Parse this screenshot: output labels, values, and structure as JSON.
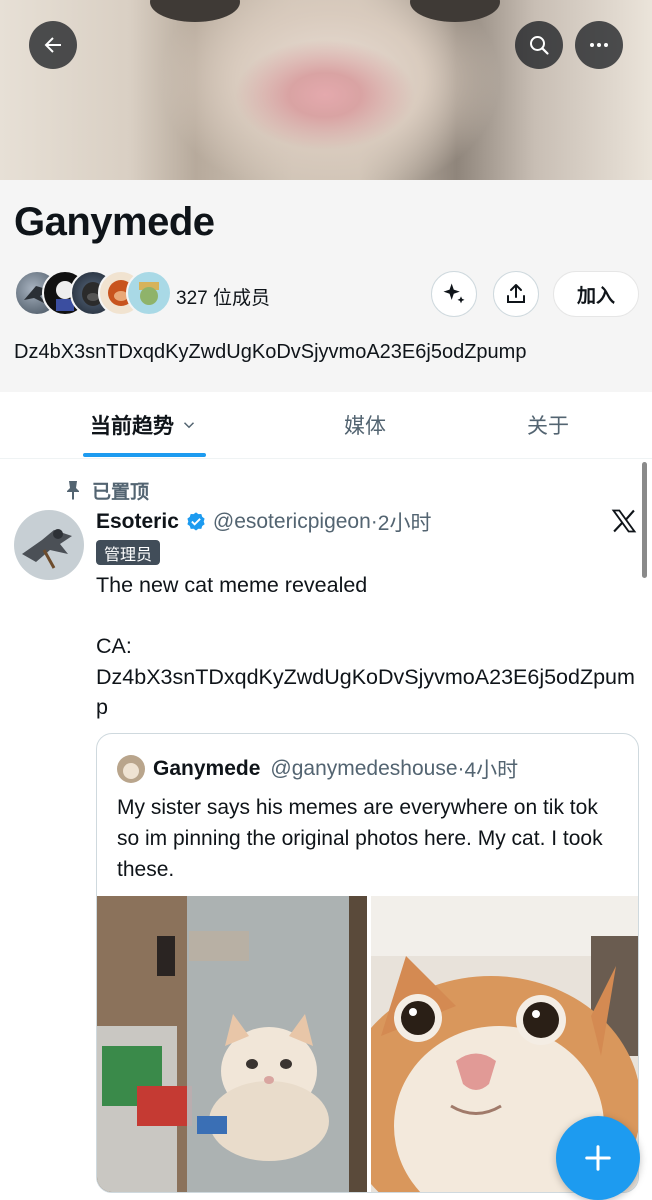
{
  "community": {
    "name": "Ganymede",
    "members_text": "327 位成员",
    "join_label": "加入",
    "description": "Dz4bX3snTDxqdKyZwdUgKoDvSjyvmoA23E6j5odZpump"
  },
  "tabs": [
    {
      "label": "当前趋势",
      "active": true
    },
    {
      "label": "媒体",
      "active": false
    },
    {
      "label": "关于",
      "active": false
    }
  ],
  "post": {
    "pinned_label": "已置顶",
    "author_name": "Esoteric",
    "handle": "@esotericpigeon",
    "separator": "·",
    "time": "2小时",
    "role_badge": "管理员",
    "text": "The new cat meme revealed\n\nCA:\nDz4bX3snTDxqdKyZwdUgKoDvSjyvmoA23E6j5odZpump",
    "quote": {
      "author_name": "Ganymede",
      "handle": "@ganymedeshouse",
      "separator": "·",
      "time": "4小时",
      "text": "My sister says his memes are everywhere on tik tok so im pinning the original photos here. My cat. I took these."
    }
  },
  "icons": {
    "back": "arrow-left-icon",
    "search": "search-icon",
    "more": "more-horizontal-icon",
    "grok": "sparkle-icon",
    "share": "share-icon",
    "pin": "pin-icon",
    "verified": "verified-badge-icon",
    "x": "x-logo-icon",
    "compose": "plus-icon"
  },
  "colors": {
    "accent": "#1d9bf0",
    "text": "#0f1419",
    "muted": "#536471",
    "admin_badge": "#414d59"
  }
}
